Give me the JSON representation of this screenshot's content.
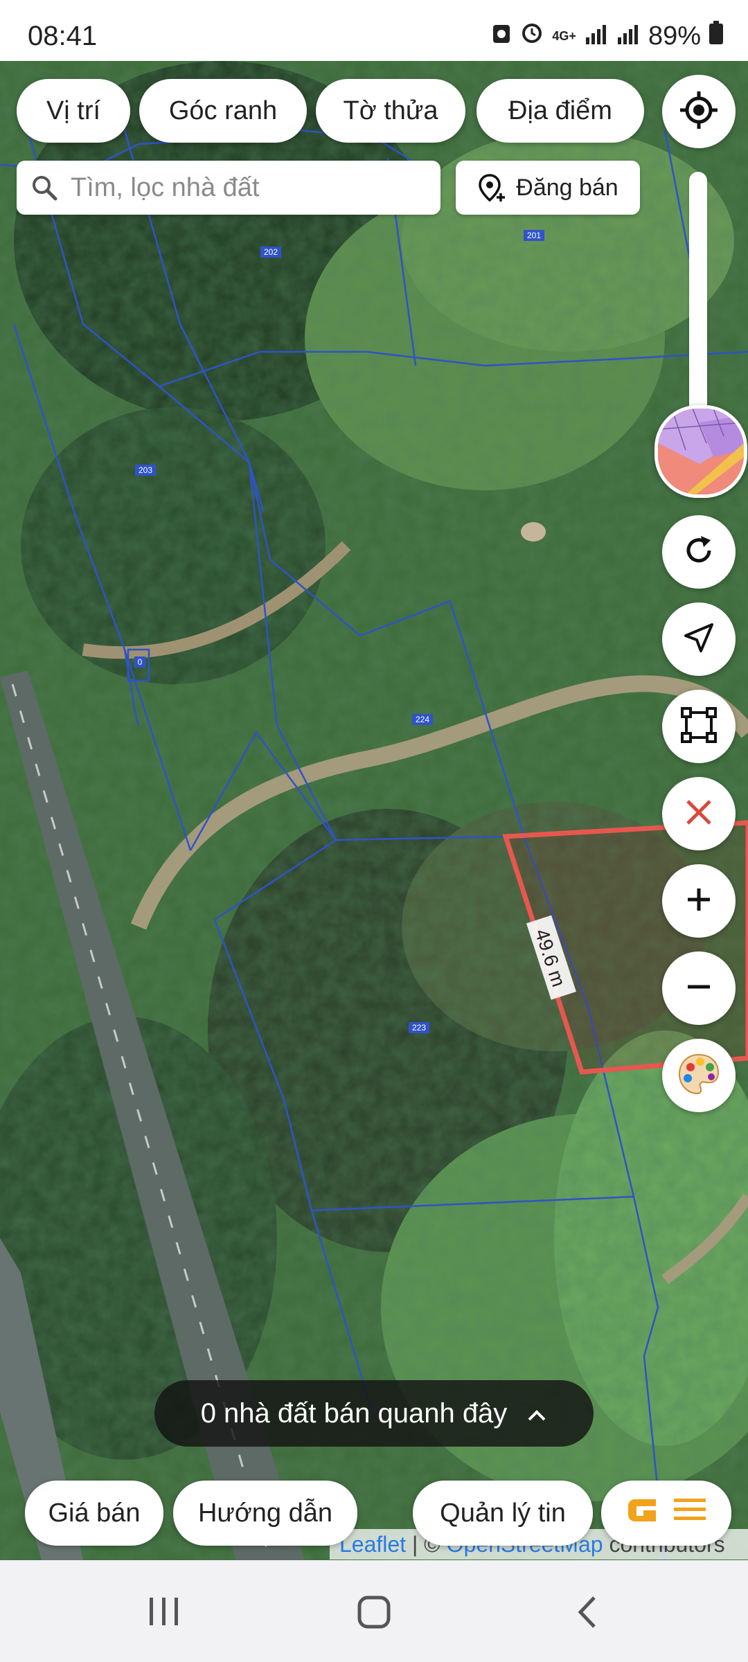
{
  "status_bar": {
    "time": "08:41",
    "network": "4G+",
    "battery": "89%"
  },
  "top_chips": {
    "location": "Vị trí",
    "boundary": "Góc ranh",
    "parcel": "Tờ thửa",
    "place": "Địa điểm"
  },
  "search": {
    "placeholder": "Tìm, lọc nhà đất"
  },
  "post_button": {
    "label": "Đăng bán"
  },
  "map": {
    "parcel_numbers": [
      "202",
      "201",
      "203",
      "0",
      "224",
      "223"
    ],
    "measurement": "49.6 m"
  },
  "nearby": {
    "label": "0 nhà đất bán quanh đây"
  },
  "bottom_chips": {
    "price": "Giá bán",
    "guide": "Hướng dẫn",
    "manage": "Quản lý tin"
  },
  "attribution": {
    "leaflet": "Leaflet",
    "separator": " | © ",
    "osm": "OpenStreetMap",
    "suffix": " contributors"
  },
  "colors": {
    "parcel_line": "#2f53c8",
    "selection": "#e8574f",
    "close_icon": "#d9483b",
    "brand_logo": "#f2a21b"
  }
}
